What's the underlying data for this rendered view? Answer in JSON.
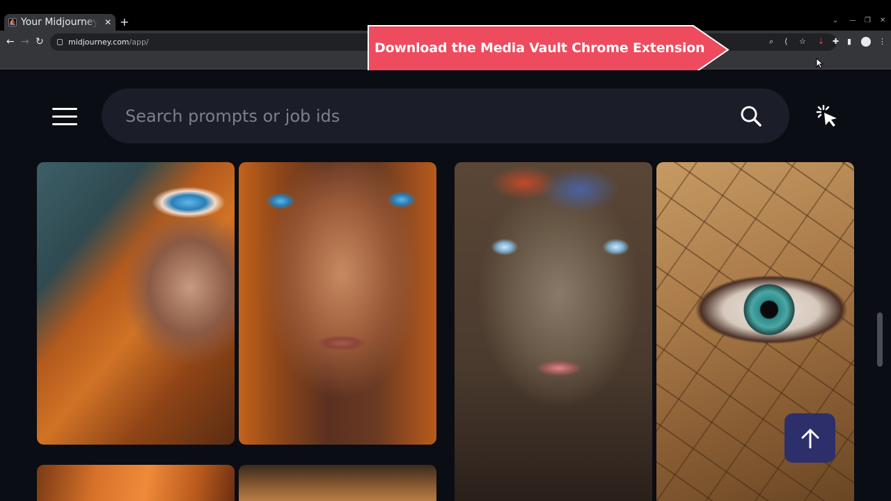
{
  "browser": {
    "tab_title": "Your Midjourney Profile",
    "tab_favicon": "midjourney-icon",
    "new_tab": "+",
    "url_host": "midjourney.com",
    "url_path": "/app/"
  },
  "banner": {
    "text": "Download the Media Vault Chrome Extension",
    "color": "#ee4b5e"
  },
  "page": {
    "search_placeholder": "Search prompts or job ids",
    "menu_icon": "hamburger-menu-icon",
    "search_icon": "search-icon",
    "sparkle_icon": "click-sparkle-icon",
    "to_top_icon": "arrow-up-icon",
    "background": "#0b0d14",
    "accent": "#2d2f6b"
  },
  "gallery": [
    {
      "name": "woman-orange-scarf-eye"
    },
    {
      "name": "woman-orange-scarf-face"
    },
    {
      "name": "woman-painted-clay-face"
    },
    {
      "name": "eye-cracked-earth"
    },
    {
      "name": "orange-fabric-partial"
    },
    {
      "name": "face-orange-light-partial"
    }
  ]
}
